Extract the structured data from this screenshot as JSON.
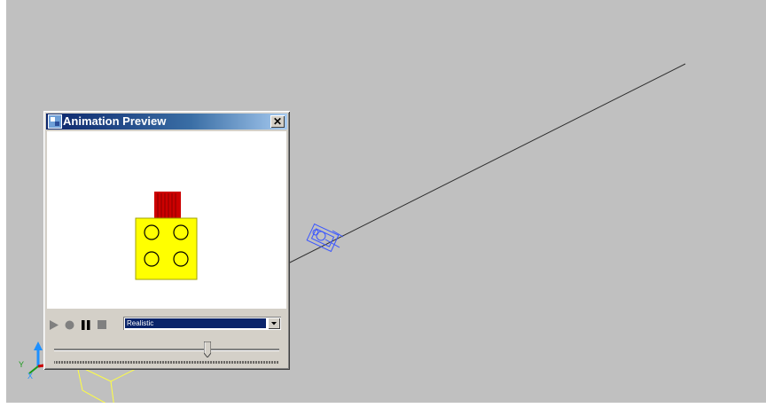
{
  "window": {
    "title": "Animation Preview",
    "close_glyph": "✕",
    "icon": "app-icon"
  },
  "controls": {
    "play": "play-icon",
    "record": "record-icon",
    "pause": "pause-icon",
    "stop": "stop-icon"
  },
  "visual_style": {
    "selected": "Realistic"
  },
  "timeline": {
    "position_fraction": 0.68
  },
  "colors": {
    "viewport_bg": "#c0c0c0",
    "brick_yellow": "#ffff00",
    "brick_red": "#cc0000",
    "camera_blue": "#3a56ff",
    "selection_yellow": "#ffff40"
  }
}
